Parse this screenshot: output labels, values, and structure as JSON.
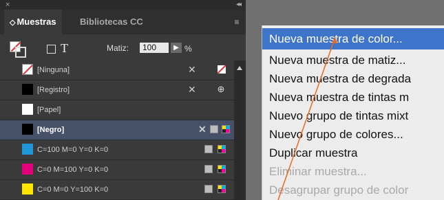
{
  "panel": {
    "topbar": {
      "close": "×",
      "collapse": "◂◂"
    },
    "tabs": [
      {
        "label": "Muestras",
        "arrows": "◇"
      },
      {
        "label": "Bibliotecas CC"
      }
    ],
    "menu_icon": "≡",
    "controls": {
      "tint_label": "Matiz:",
      "tint_value": "100",
      "tint_stepper": "▶",
      "tint_unit": "%",
      "text_toggle": "T"
    },
    "swatches": [
      {
        "name": "[Ninguna]",
        "color": "none"
      },
      {
        "name": "[Registro]",
        "color": "#000000"
      },
      {
        "name": "[Papel]",
        "color": "#ffffff"
      },
      {
        "name": "[Negro]",
        "color": "#000000",
        "selected": true
      },
      {
        "name": "C=100 M=0 Y=0 K=0",
        "color": "#1e96d8"
      },
      {
        "name": "C=0 M=100 Y=0 K=0",
        "color": "#e4007c"
      },
      {
        "name": "C=0 M=0 Y=100 K=0",
        "color": "#ffe600"
      }
    ]
  },
  "flyout_menu": {
    "items": [
      {
        "label": "Nueva muestra de color...",
        "state": "highlighted"
      },
      {
        "label": "Nueva muestra de matiz...",
        "state": "enabled"
      },
      {
        "label": "Nueva muestra de degrada",
        "state": "enabled"
      },
      {
        "label": "Nueva muestra de tintas m",
        "state": "enabled"
      },
      {
        "label": "Nuevo grupo de tintas mixt",
        "state": "enabled"
      },
      {
        "label": "Nuevo grupo de colores...",
        "state": "enabled"
      },
      {
        "label": "Duplicar muestra",
        "state": "enabled"
      },
      {
        "label": "Eliminar muestra...",
        "state": "disabled"
      },
      {
        "label": "Desagrupar grupo de color",
        "state": "disabled"
      }
    ]
  },
  "colors": {
    "highlight": "#3e74c9",
    "annotation_arrow": "#e86a1e",
    "selected_row": "#465066"
  }
}
